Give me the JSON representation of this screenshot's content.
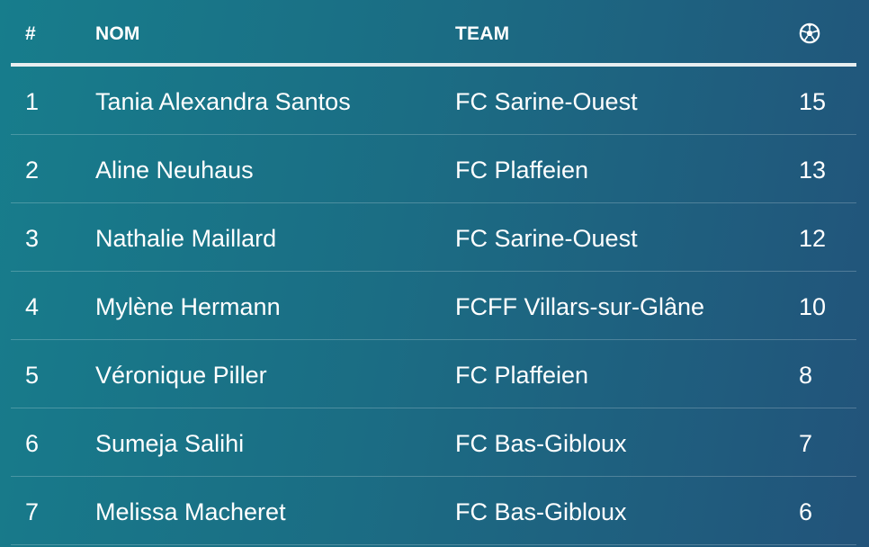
{
  "table": {
    "headers": {
      "rank": "#",
      "name": "NOM",
      "team": "TEAM",
      "goals_icon": "soccer-ball-icon"
    },
    "rows": [
      {
        "rank": "1",
        "name": "Tania Alexandra Santos",
        "team": "FC Sarine-Ouest",
        "goals": "15"
      },
      {
        "rank": "2",
        "name": "Aline Neuhaus",
        "team": "FC Plaffeien",
        "goals": "13"
      },
      {
        "rank": "3",
        "name": "Nathalie Maillard",
        "team": "FC Sarine-Ouest",
        "goals": "12"
      },
      {
        "rank": "4",
        "name": "Mylène Hermann",
        "team": "FCFF Villars-sur-Glâne",
        "goals": "10"
      },
      {
        "rank": "5",
        "name": "Véronique Piller",
        "team": "FC Plaffeien",
        "goals": "8"
      },
      {
        "rank": "6",
        "name": "Sumeja Salihi",
        "team": "FC Bas-Gibloux",
        "goals": "7"
      },
      {
        "rank": "7",
        "name": "Melissa Macheret",
        "team": "FC Bas-Gibloux",
        "goals": "6"
      }
    ]
  },
  "colors": {
    "background_start": "#177d8c",
    "background_end": "#22537a",
    "text": "#ffffff",
    "header_rule": "#e8eef0"
  }
}
